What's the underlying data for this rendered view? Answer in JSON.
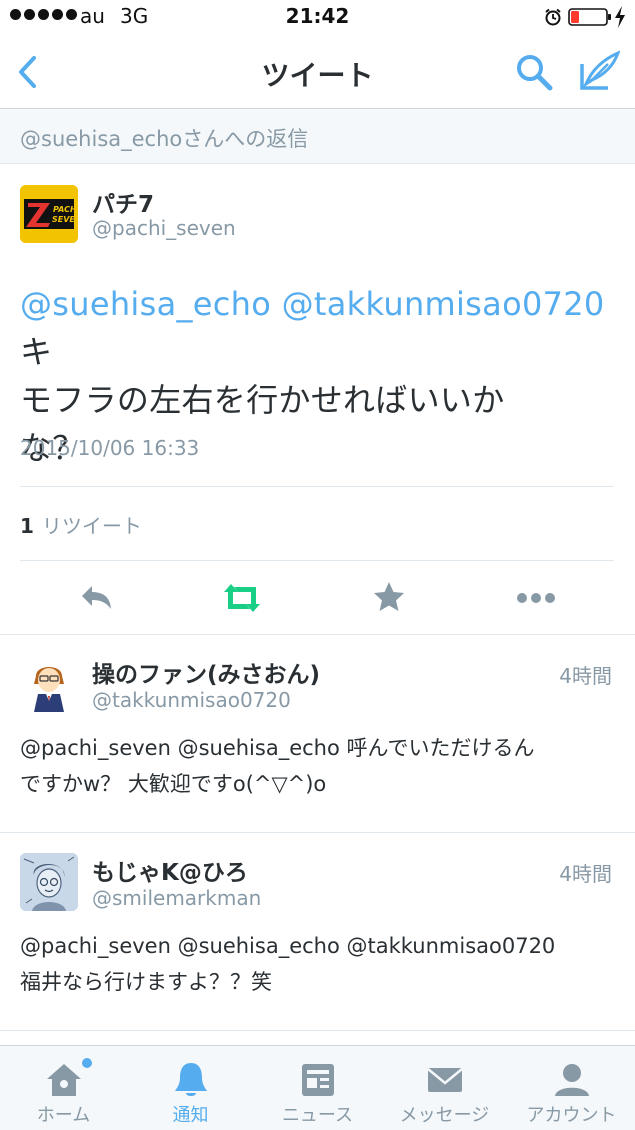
{
  "status_bar": {
    "carrier": "au",
    "network": "3G",
    "time": "21:42"
  },
  "nav": {
    "title": "ツイート",
    "back_icon": "chevron-left-icon",
    "search_icon": "search-icon",
    "compose_icon": "compose-icon"
  },
  "reply_banner": {
    "text": "@suehisa_echoさんへの返信"
  },
  "main_tweet": {
    "author_name": "パチ7",
    "author_handle": "@pachi_seven",
    "mention_1": "@suehisa_echo",
    "mention_2": "@takkunmisao0720",
    "text_rest_1": "キ",
    "text_rest_2": "モフラの左右を行かせればいいか",
    "text_rest_3": "な？",
    "timestamp": "2015/10/06 16:33",
    "retweet_count": "1",
    "retweet_label": "リツイート"
  },
  "replies": [
    {
      "name": "操のファン(みさおん)",
      "handle": "@takkunmisao0720",
      "time": "4時間",
      "line_1": "@pachi_seven @suehisa_echo 呼んでいただけるん",
      "line_2": "ですかw？ 大歓迎ですo(^▽^)o"
    },
    {
      "name": "もじゃK@ひろ",
      "handle": "@smilemarkman",
      "time": "4時間",
      "line_1": "@pachi_seven @suehisa_echo @takkunmisao0720",
      "line_2": "福井なら行けますよ？？笑"
    }
  ],
  "tabs": [
    {
      "label": "ホーム",
      "icon": "home-icon"
    },
    {
      "label": "通知",
      "icon": "bell-icon"
    },
    {
      "label": "ニュース",
      "icon": "news-icon"
    },
    {
      "label": "メッセージ",
      "icon": "envelope-icon"
    },
    {
      "label": "アカウント",
      "icon": "person-icon"
    }
  ],
  "colors": {
    "accent": "#55acee",
    "retweet_green": "#19cf86",
    "text": "#292f33",
    "muted": "#8899a6"
  }
}
